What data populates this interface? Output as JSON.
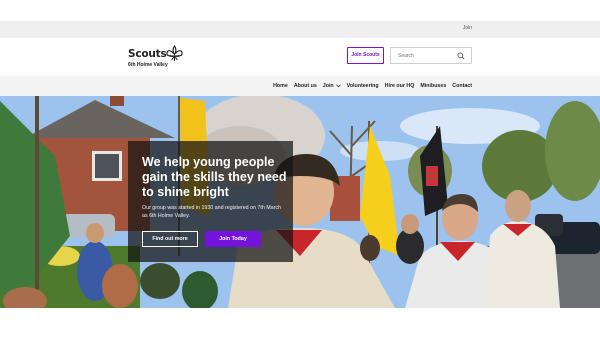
{
  "utility_bar": {
    "join_label": "Join"
  },
  "logo": {
    "wordmark": "Scouts",
    "group_name": "6th Holme Valley"
  },
  "header": {
    "join_button_label": "Join Scouts",
    "search_placeholder": "Search"
  },
  "nav": {
    "items": [
      {
        "label": "Home"
      },
      {
        "label": "About us"
      },
      {
        "label": "Join",
        "has_dropdown": true
      },
      {
        "label": "Volunteering"
      },
      {
        "label": "Hire our HQ"
      },
      {
        "label": "Minibuses"
      },
      {
        "label": "Contact"
      }
    ]
  },
  "hero": {
    "headline": "We help young people gain the skills they need to shine bright",
    "body": "Our group was started in 1930 and registered on 7th March as 6th Holme Valley.",
    "primary_cta": "Find out more",
    "secondary_cta": "Join Today"
  },
  "colors": {
    "brand_purple": "#7413dc",
    "overlay": "#141414",
    "navbar_bg": "#f4f4f4"
  }
}
